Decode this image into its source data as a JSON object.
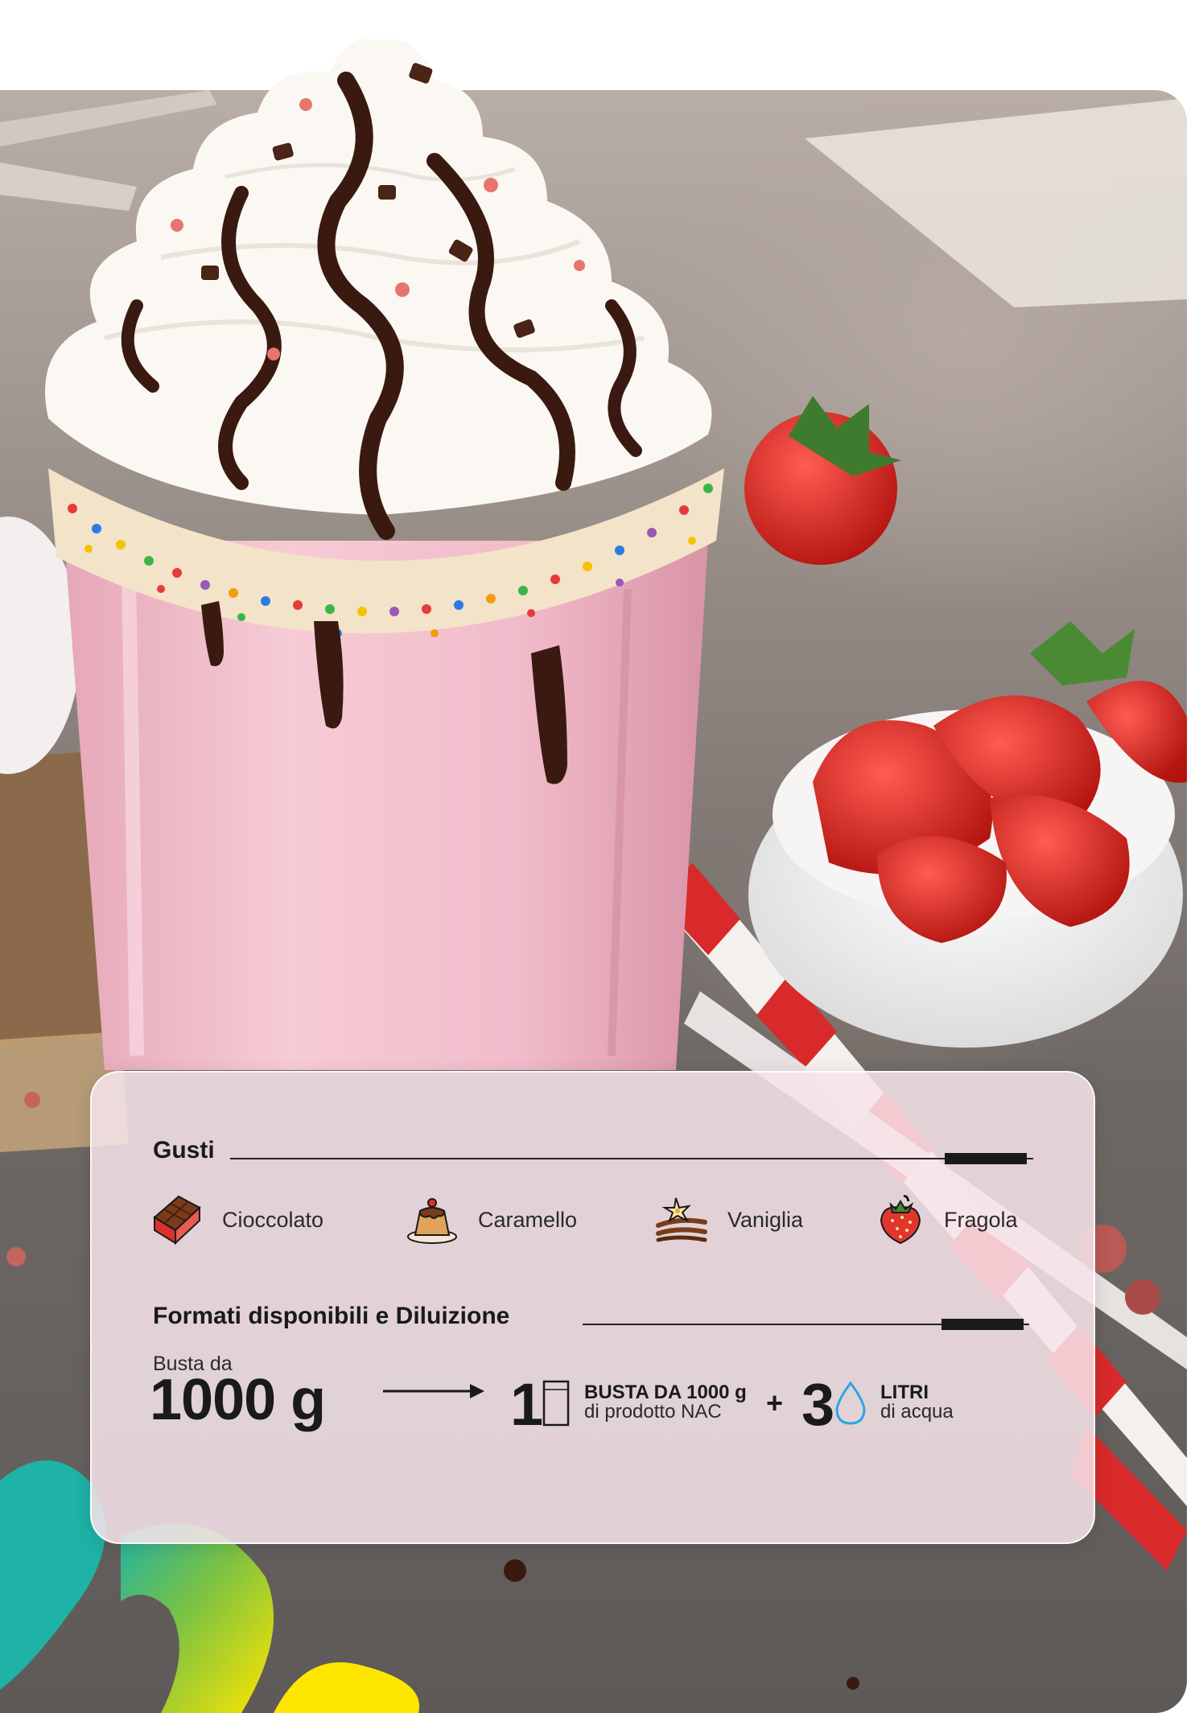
{
  "colors": {
    "card_bg": "#f6e4ea",
    "text_dark": "#1a1a1a",
    "milkshake_pink": "#f2bccb",
    "strawberry_red": "#e0362f",
    "water_blue": "#27a8e0",
    "brand_teal": "#1fb2a6",
    "brand_green": "#7cc242",
    "brand_yellow": "#ffe600"
  },
  "image": {
    "alt": "Strawberry milkshake with whipped cream, chocolate sauce and sprinkles, bowl of strawberries and striped straws"
  },
  "flavors": {
    "title": "Gusti",
    "items": [
      {
        "label": "Cioccolato",
        "icon": "chocolate-bar-icon"
      },
      {
        "label": "Caramello",
        "icon": "caramel-pudding-icon"
      },
      {
        "label": "Vaniglia",
        "icon": "vanilla-flower-icon"
      },
      {
        "label": "Fragola",
        "icon": "strawberry-icon"
      }
    ]
  },
  "formats": {
    "title": "Formati disponibili e Diluizione",
    "pack_prefix": "Busta da",
    "pack_size": "1000 g",
    "bag_count": "1",
    "bag_line1": "BUSTA DA 1000 g",
    "bag_line2": "di prodotto NAC",
    "plus": "+",
    "water_count": "3",
    "water_line1": "LITRI",
    "water_line2": "di acqua"
  }
}
